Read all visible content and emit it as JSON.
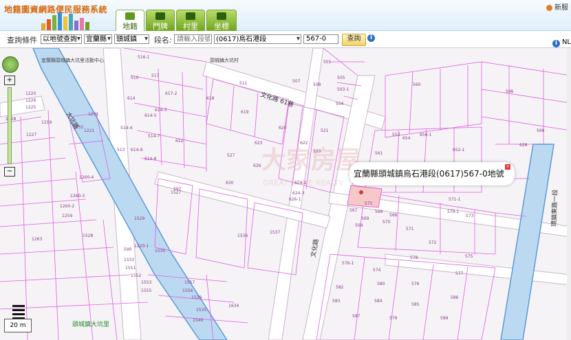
{
  "header": {
    "logo_text": "地籍圖資網路便民服務系統",
    "tabs": [
      {
        "label": "地籍",
        "active": true
      },
      {
        "label": "門牌",
        "active": false
      },
      {
        "label": "村里",
        "active": false
      },
      {
        "label": "坐標",
        "active": false
      }
    ],
    "top_right_label": "新服"
  },
  "query": {
    "condition_label": "查詢條件",
    "mode_value": "以地號查詢",
    "county_value": "宜蘭縣",
    "town_value": "頭城鎮",
    "section_label": "段名:",
    "section_placeholder": "請輸入段號",
    "section_value": "(0617)烏石港段",
    "parcel_value": "567-0",
    "search_label": "查詢",
    "nlsc_label": "NL"
  },
  "map": {
    "popup_text": "宜蘭縣頭城鎮烏石港段(0617)567-0地號",
    "scale_text": "20 m",
    "watermark_text": "大家房屋",
    "watermark_sub": "GREAT HOME REALTY",
    "street_labels": [
      "文化路 61巷",
      "文化路",
      "大坑路",
      "頭城鎮大坑里",
      "環鎮東路一段",
      "頭城鎮大坑里"
    ],
    "building_labels": [
      "宜蘭縣頭城鎮大坑里活動中心",
      "頭城鎮大坑村"
    ],
    "parcel_labels": [
      "516-1",
      "517",
      "510",
      "617-2",
      "618",
      "619",
      "511",
      "507",
      "508",
      "505",
      "503-1",
      "504",
      "501",
      "560",
      "546",
      "614",
      "614-3",
      "614-5",
      "514-4",
      "514-7",
      "614-8",
      "620",
      "612",
      "614-9",
      "513",
      "521",
      "553",
      "654",
      "656-1",
      "628",
      "566",
      "622",
      "623",
      "527",
      "626",
      "630",
      "624-2",
      "624-3",
      "523",
      "626-1",
      "509",
      "561",
      "652-1",
      "597",
      "1260-4",
      "1260-3",
      "1260-2",
      "1259",
      "1263",
      "1232",
      "1231",
      "1221",
      "1220",
      "1226",
      "1225",
      "1227",
      "1228",
      "1219",
      "1220-1",
      "1529",
      "1528",
      "1527",
      "566",
      "575",
      "567",
      "568",
      "569",
      "570",
      "571",
      "571-1",
      "573",
      "579-1",
      "572",
      "575",
      "576-1",
      "578",
      "577",
      "574",
      "580",
      "576",
      "582",
      "583",
      "584",
      "585",
      "586",
      "587",
      "579",
      "589",
      "590",
      "1530",
      "1532",
      "1551",
      "1552",
      "1553",
      "1555",
      "1556",
      "1557",
      "1540",
      "1535",
      "1539",
      "1537",
      "1536",
      "1634",
      "1633",
      "1581"
    ],
    "colors": {
      "parcel_line": "#e05ee0",
      "road": "#ffffff",
      "river": "#bcd9f2",
      "river_edge": "#5a9ad6",
      "highlight": "#f7c8c8",
      "tab_green": "#6ea41e",
      "accent_orange": "#d86a10"
    }
  }
}
